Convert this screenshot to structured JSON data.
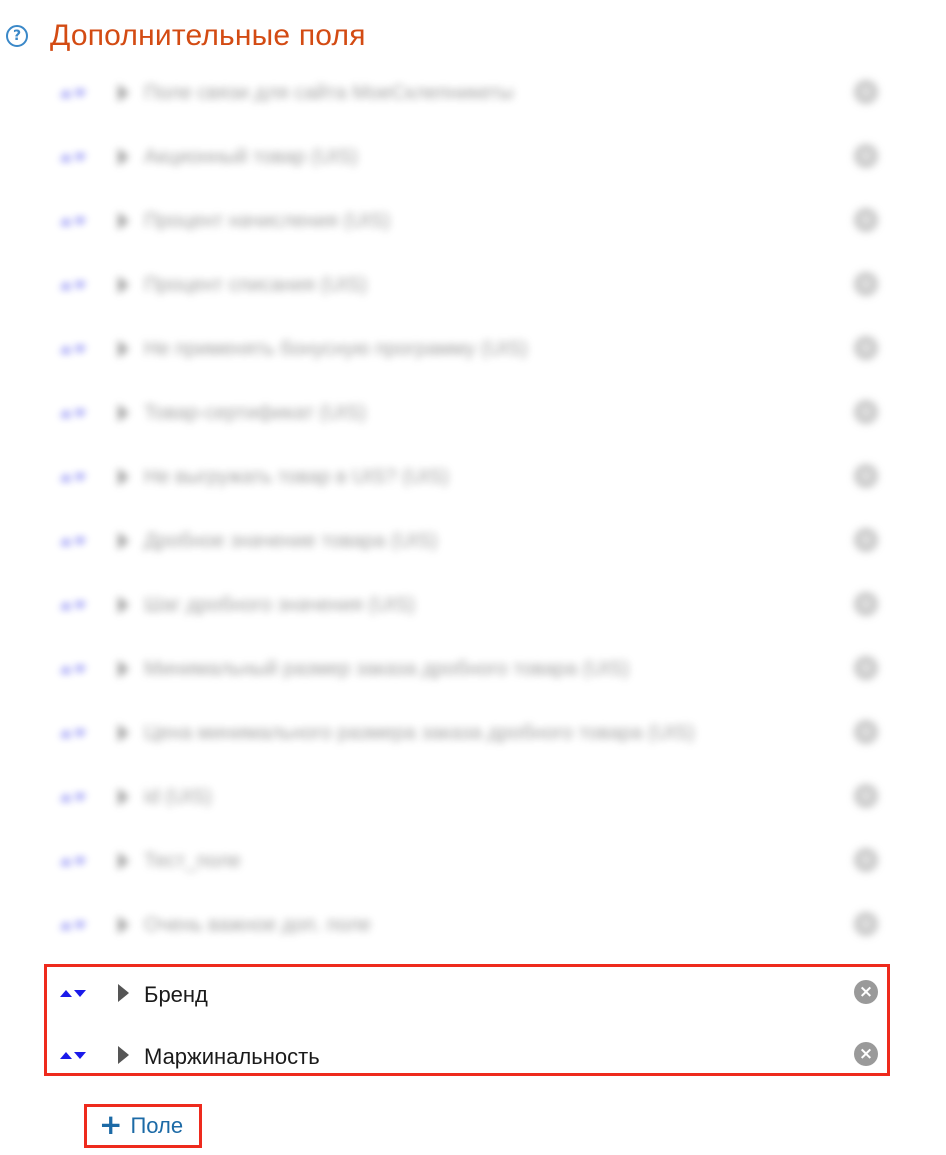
{
  "header": {
    "help_icon": "question-mark",
    "title": "Дополнительные поля"
  },
  "fields_blurred": [
    {
      "label": "Поле связи для сайта МоеСклепникеты"
    },
    {
      "label": "Акционный товар (UIS)"
    },
    {
      "label": "Процент начисления (UIS)"
    },
    {
      "label": "Процент списания (UIS)"
    },
    {
      "label": "Не применять бонусную программу (UIS)"
    },
    {
      "label": "Товар-сертификат (UIS)"
    },
    {
      "label": "Не выгружать товар в UIS? (UIS)"
    },
    {
      "label": "Дробное значение товара (UIS)"
    },
    {
      "label": "Шаг дробного значения (UIS)"
    },
    {
      "label": "Минимальный размер заказа дробного товара (UIS)"
    },
    {
      "label": "Цена минимального размера заказа дробного товара (UIS)"
    },
    {
      "label": "id (UIS)"
    },
    {
      "label": "Тест_поле"
    },
    {
      "label": "Очень важное доп. поле"
    }
  ],
  "fields_visible": [
    {
      "label": "Бренд"
    },
    {
      "label": "Маржинальность"
    }
  ],
  "add_button": {
    "icon": "plus",
    "label": "Поле"
  },
  "colors": {
    "title": "#d34b13",
    "help_icon": "#3a88c8",
    "sort_arrows": "#1a1aea",
    "remove_icon": "#9a9a9a",
    "highlight": "#ee2a1d",
    "link": "#1c6aa6"
  }
}
